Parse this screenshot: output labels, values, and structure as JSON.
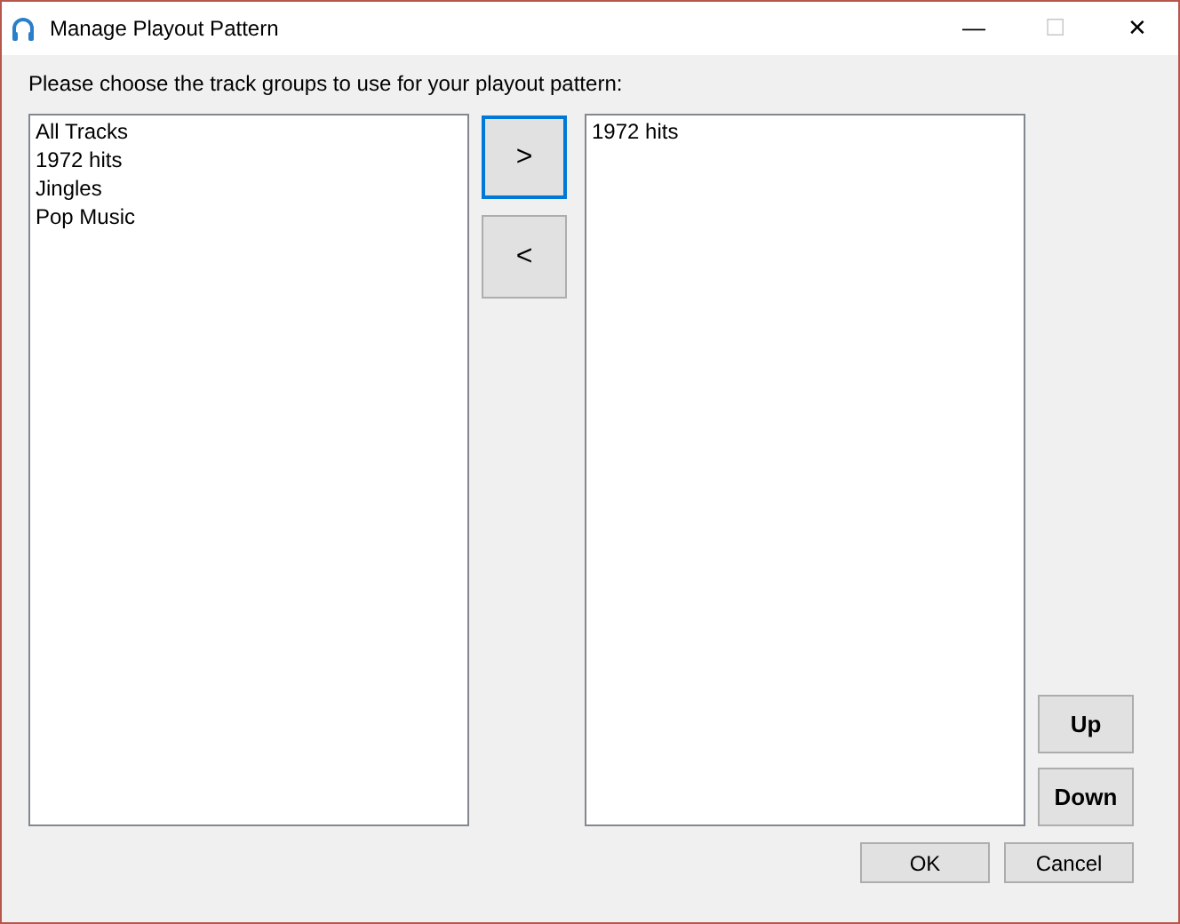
{
  "window": {
    "title": "Manage Playout Pattern",
    "controls": [
      "—",
      "☐",
      "✕"
    ]
  },
  "instruction": "Please choose the track groups to use for your playout pattern:",
  "available_list": {
    "items": [
      "All Tracks",
      "1972 hits",
      "Jingles",
      "Pop Music"
    ]
  },
  "move_buttons": [
    {
      "label": ">",
      "focused": true
    },
    {
      "label": "<",
      "focused": false
    }
  ],
  "selected_list": {
    "items": [
      "1972 hits"
    ]
  },
  "order_buttons": [
    "Up",
    "Down"
  ],
  "buttons": [
    "OK",
    "Cancel"
  ]
}
